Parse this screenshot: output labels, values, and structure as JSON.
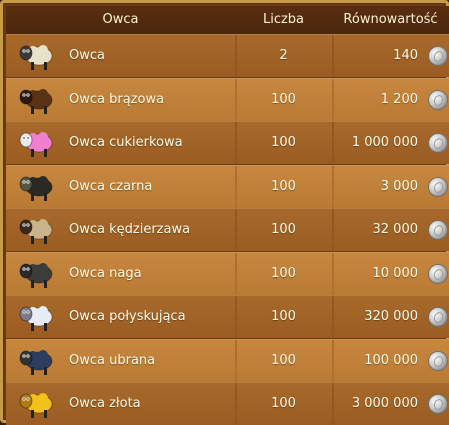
{
  "table": {
    "headers": {
      "name": "Owca",
      "count": "Liczba",
      "value": "Równowartość"
    },
    "rows": [
      {
        "name": "Owca",
        "count": "2",
        "value": "140",
        "icon": "white-sheep-icon",
        "wool": "#e8e2c8",
        "face": "#3a3a3a"
      },
      {
        "name": "Owca brązowa",
        "count": "100",
        "value": "1 200",
        "icon": "brown-sheep-icon",
        "wool": "#5a3215",
        "face": "#2b1a0d"
      },
      {
        "name": "Owca cukierkowa",
        "count": "100",
        "value": "1 000 000",
        "icon": "candy-sheep-icon",
        "wool": "#f07fd0",
        "face": "#e8e8e8"
      },
      {
        "name": "Owca czarna",
        "count": "100",
        "value": "3 000",
        "icon": "black-sheep-icon",
        "wool": "#2a2a24",
        "face": "#555545"
      },
      {
        "name": "Owca kędzierzawa",
        "count": "100",
        "value": "32 000",
        "icon": "curly-sheep-icon",
        "wool": "#c9b48a",
        "face": "#3a2818"
      },
      {
        "name": "Owca naga",
        "count": "100",
        "value": "10 000",
        "icon": "naked-sheep-icon",
        "wool": "#3c3c3c",
        "face": "#2a2a2a"
      },
      {
        "name": "Owca połyskująca",
        "count": "100",
        "value": "320 000",
        "icon": "shiny-sheep-icon",
        "wool": "#e8ecf4",
        "face": "#7a7a88"
      },
      {
        "name": "Owca ubrana",
        "count": "100",
        "value": "100 000",
        "icon": "dressed-sheep-icon",
        "wool": "#2d3d60",
        "face": "#333333"
      },
      {
        "name": "Owca złota",
        "count": "100",
        "value": "3 000 000",
        "icon": "golden-sheep-icon",
        "wool": "#f2c21a",
        "face": "#b07a10"
      }
    ],
    "currency_icon": "silver-coin-icon"
  }
}
